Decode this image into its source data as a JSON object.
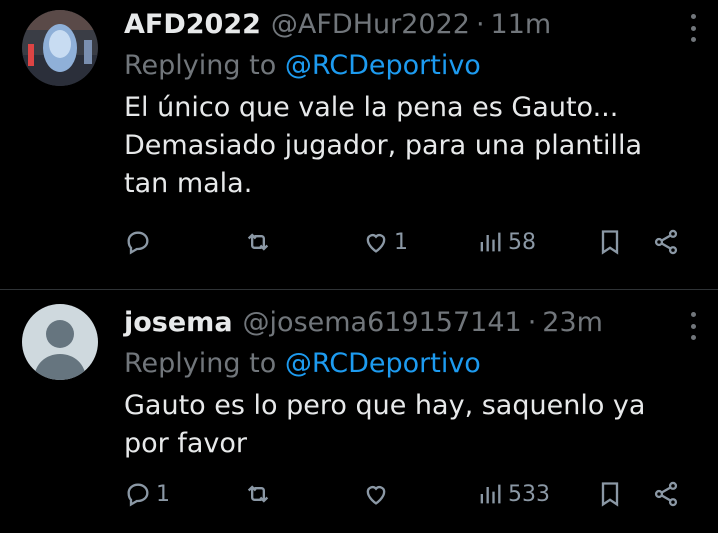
{
  "tweets": [
    {
      "name": "AFD2022",
      "handle": "@AFDHur2022",
      "time": "11m",
      "replying_prefix": "Replying to",
      "replying_to": "@RCDeportivo",
      "text": "El único que vale la pena es Gauto...\nDemasiado jugador,  para una plantilla\ntan mala.",
      "reply_count": "",
      "like_count": "1",
      "view_count": "58"
    },
    {
      "name": "josema",
      "handle": "@josema619157141",
      "time": "23m",
      "replying_prefix": "Replying to",
      "replying_to": "@RCDeportivo",
      "text": "Gauto es lo pero que hay, saquenlo ya\npor favor",
      "reply_count": "1",
      "like_count": "",
      "view_count": "533"
    }
  ],
  "separator": "·",
  "icons": [
    "reply-icon",
    "retweet-icon",
    "like-icon",
    "views-icon",
    "bookmark-icon",
    "share-icon",
    "more-icon"
  ],
  "colors": {
    "background": "#000000",
    "text": "#e7e9ea",
    "muted": "#71767b",
    "link": "#1d9bf0",
    "divider": "#2f3336"
  }
}
